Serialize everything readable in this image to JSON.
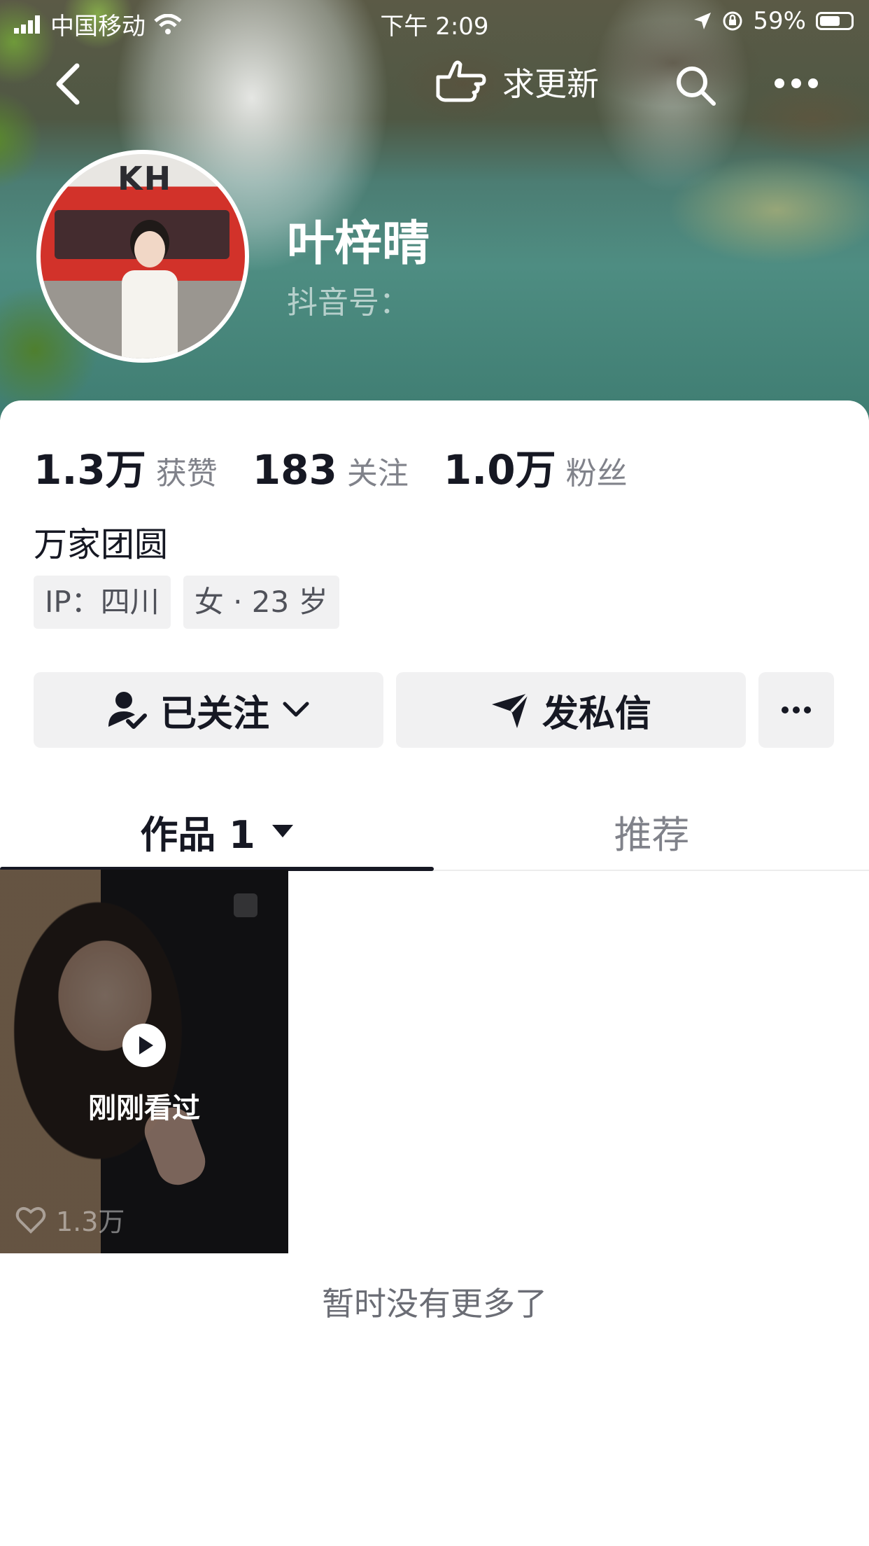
{
  "status_bar": {
    "carrier": "中国移动",
    "time": "下午 2:09",
    "battery": "59%"
  },
  "nav": {
    "update_label": "求更新"
  },
  "profile": {
    "name": "叶梓晴",
    "douyin_id_label": "抖音号：",
    "bio": "万家团圆",
    "tags": [
      "IP：四川",
      "女 · 23 岁"
    ]
  },
  "stats": [
    {
      "num": "1.3万",
      "label": "获赞"
    },
    {
      "num": "183",
      "label": "关注"
    },
    {
      "num": "1.0万",
      "label": "粉丝"
    }
  ],
  "actions": {
    "follow_label": "已关注",
    "message_label": "发私信"
  },
  "tabs": {
    "works_label": "作品 1",
    "recommend_label": "推荐"
  },
  "video": {
    "overlay_text": "刚刚看过",
    "likes": "1.3万"
  },
  "footer_text": "暂时没有更多了",
  "colors": {
    "primary_text": "#161823",
    "secondary_text": "#80828a",
    "button_bg": "#f1f1f2"
  }
}
